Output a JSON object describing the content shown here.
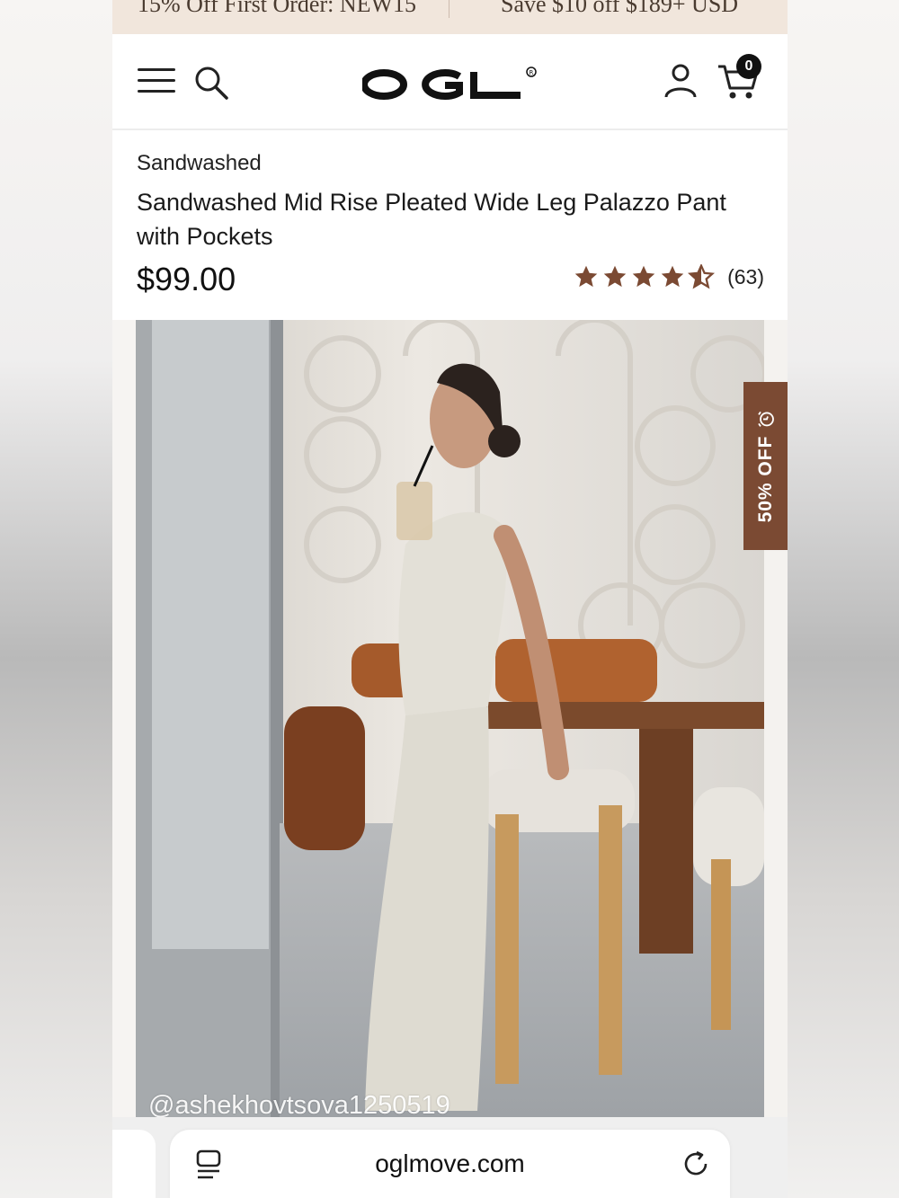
{
  "promo": {
    "left_text": "15% Off First Order: NEW15",
    "right_text": "Save $10 off $189+ USD"
  },
  "header": {
    "logo_text": "OGL",
    "cart_count": "0"
  },
  "product": {
    "brand": "Sandwashed",
    "title": "Sandwashed Mid Rise Pleated Wide Leg Palazzo Pant with Pockets",
    "price": "$99.00",
    "rating_value": 4.5,
    "rating_max": 5,
    "review_count": "(63)",
    "star_color": "#7b4a33"
  },
  "image": {
    "caption": "@ashekhovtsova1250519"
  },
  "sale_tab": {
    "label": "50% OFF",
    "color": "#7b4a33"
  },
  "browser": {
    "url": "oglmove.com"
  }
}
